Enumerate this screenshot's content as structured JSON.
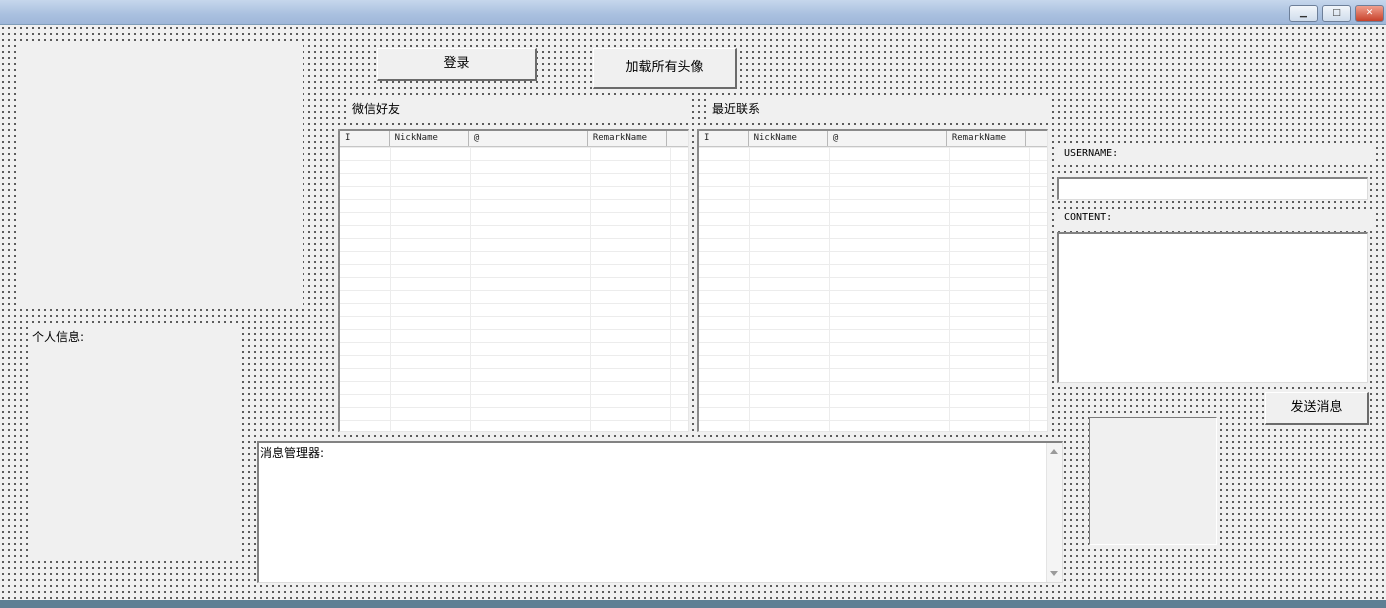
{
  "window": {
    "minimize_glyph": "▁",
    "maximize_glyph": "□",
    "close_glyph": "✕"
  },
  "toolbar": {
    "login_label": "登录",
    "load_avatars_label": "加载所有头像"
  },
  "friends": {
    "title": "微信好友",
    "columns": [
      "I",
      "NickName",
      "@",
      "RemarkName"
    ]
  },
  "recent": {
    "title": "最近联系",
    "columns": [
      "I",
      "NickName",
      "@",
      "RemarkName"
    ]
  },
  "profile": {
    "label": "个人信息:"
  },
  "message_manager": {
    "label": "消息管理器:"
  },
  "send_form": {
    "username_label": "USERNAME:",
    "username_value": "",
    "content_label": "CONTENT:",
    "content_value": "",
    "send_label": "发送消息"
  },
  "colors": {
    "face": "#f0f0f0",
    "title_gradient": "#a9c0df",
    "close_button": "#c7412a"
  }
}
